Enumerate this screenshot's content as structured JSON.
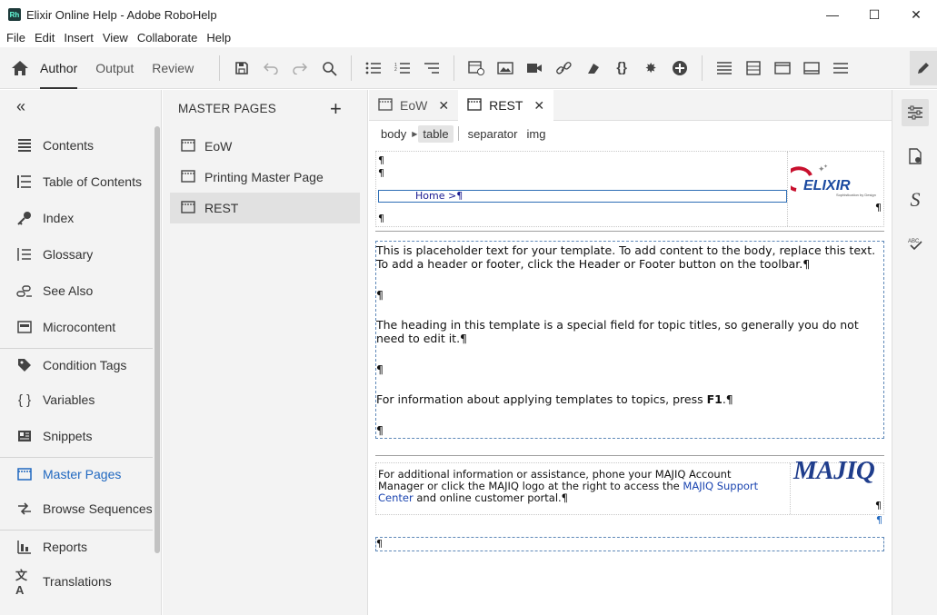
{
  "window": {
    "title": "Elixir Online Help - Adobe RoboHelp",
    "app_icon_text": "Rh",
    "minimize": "—",
    "maximize": "☐",
    "close": "✕"
  },
  "menu": [
    "File",
    "Edit",
    "Insert",
    "View",
    "Collaborate",
    "Help"
  ],
  "toolbar": {
    "tabs": [
      "Author",
      "Output",
      "Review"
    ],
    "active_tab": "Author"
  },
  "left_nav": {
    "items": [
      {
        "label": "Contents",
        "icon": "contents-icon"
      },
      {
        "label": "Table of Contents",
        "icon": "toc-icon"
      },
      {
        "label": "Index",
        "icon": "index-icon"
      },
      {
        "label": "Glossary",
        "icon": "glossary-icon"
      },
      {
        "label": "See Also",
        "icon": "see-also-icon"
      },
      {
        "label": "Microcontent",
        "icon": "microcontent-icon"
      },
      {
        "label": "Condition Tags",
        "icon": "tag-icon"
      },
      {
        "label": "Variables",
        "icon": "braces-icon"
      },
      {
        "label": "Snippets",
        "icon": "snippet-icon"
      },
      {
        "label": "Master Pages",
        "icon": "master-page-icon"
      },
      {
        "label": "Browse Sequences",
        "icon": "browse-icon"
      },
      {
        "label": "Reports",
        "icon": "reports-icon"
      },
      {
        "label": "Translations",
        "icon": "translate-icon"
      }
    ],
    "active_item": "Master Pages"
  },
  "master_pages": {
    "title": "MASTER PAGES",
    "add": "+",
    "items": [
      "EoW",
      "Printing Master Page",
      "REST"
    ],
    "selected": "REST"
  },
  "editor": {
    "tabs": [
      {
        "label": "EoW",
        "close": "✕"
      },
      {
        "label": "REST",
        "close": "✕"
      }
    ],
    "active_tab": "REST",
    "breadcrumb": [
      "body",
      "table",
      "separator",
      "img"
    ],
    "active_crumb": "table",
    "header": {
      "pilcrow": "¶",
      "home_link": "Home >¶",
      "logo_text": "ELIXIR",
      "logo_tagline": "Sophistication by Design"
    },
    "body": {
      "p1": "This is placeholder text for your template. To add content to the body, replace this text. To add a header or footer, click the Header or Footer button on the toolbar.¶",
      "p2": "¶",
      "p3": "The heading in this template is a special field for topic titles, so generally you do not need to edit it.¶",
      "p4": "¶",
      "p5_before": "For information about applying templates to topics, press ",
      "p5_key": "F1",
      "p5_after": ".¶",
      "p6": "¶"
    },
    "footer": {
      "text_before": "For additional information or assistance, phone your MAJIQ Account Manager or click the MAJIQ logo at the right to access the ",
      "link": "MAJIQ Support Center",
      "text_after": " and online customer portal.¶",
      "logo_text": "MAJIQ",
      "pilcrow": "¶",
      "pilcrow_blue": "¶"
    },
    "last_pilcrow": "¶"
  },
  "colors": {
    "accent": "#2068c0",
    "panel_bg": "#f3f3f3",
    "majiq_logo": "#1f3d8c",
    "elixir_red": "#c8102e",
    "elixir_blue": "#1b4aa0"
  }
}
